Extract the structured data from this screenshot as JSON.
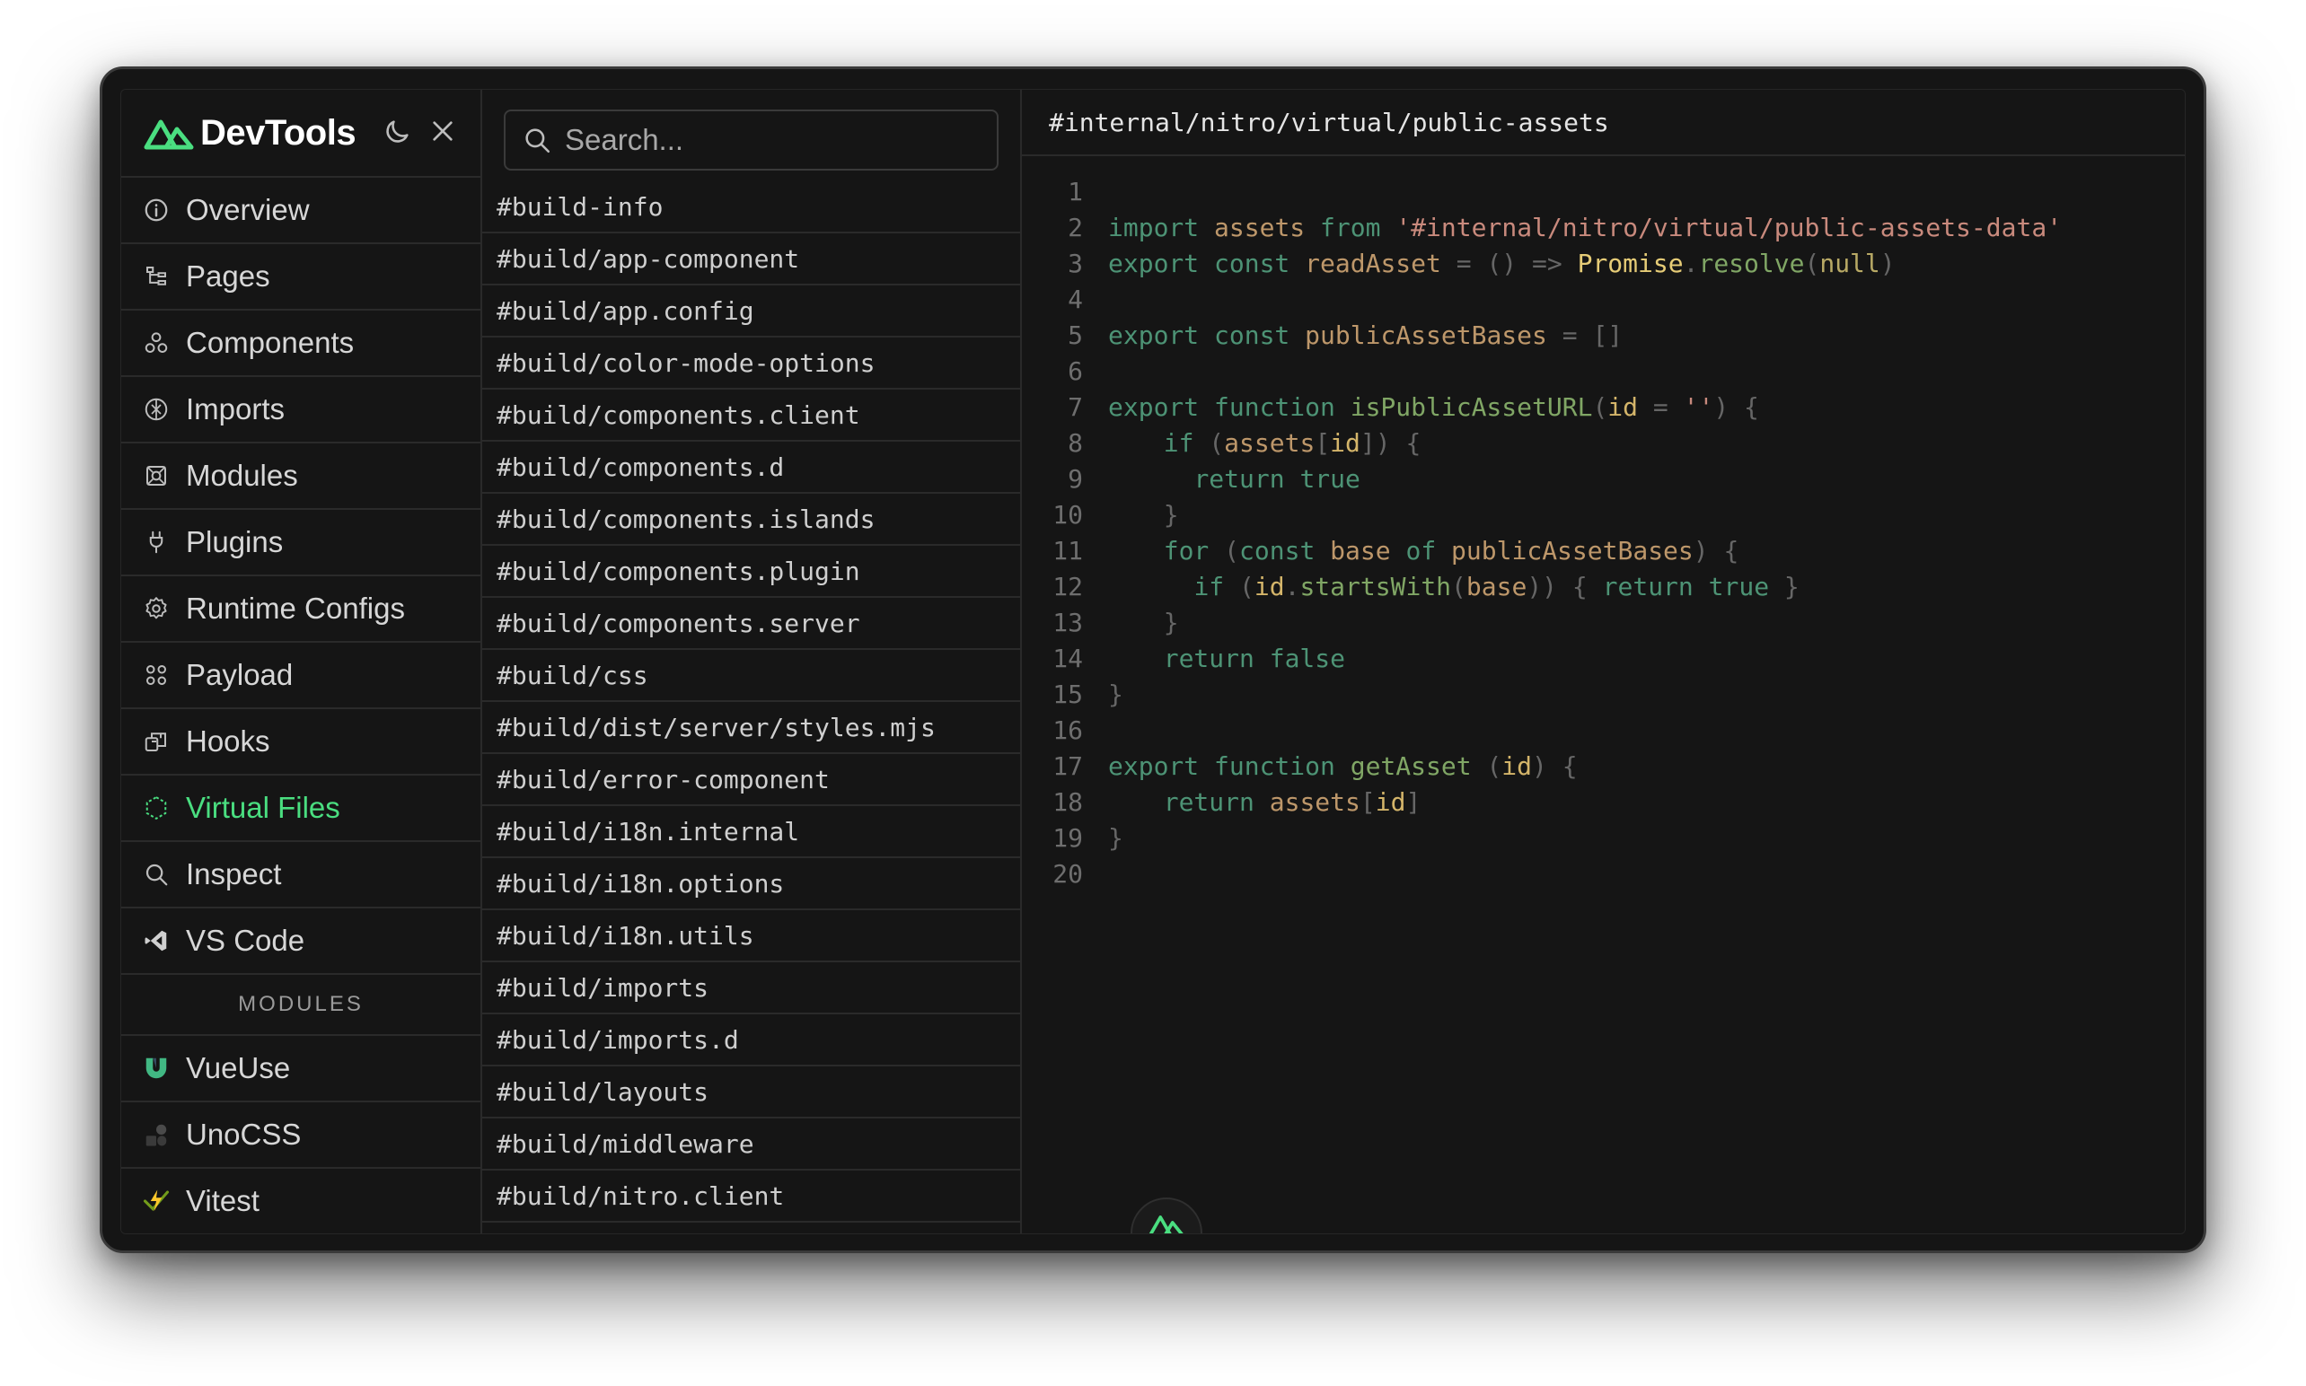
{
  "app": {
    "title": "DevTools",
    "accent": "#4ade80"
  },
  "sidebar": {
    "items": [
      {
        "label": "Overview",
        "icon": "info-circle-icon"
      },
      {
        "label": "Pages",
        "icon": "tree-icon"
      },
      {
        "label": "Components",
        "icon": "components-icon"
      },
      {
        "label": "Imports",
        "icon": "imports-icon"
      },
      {
        "label": "Modules",
        "icon": "modules-icon"
      },
      {
        "label": "Plugins",
        "icon": "plug-icon"
      },
      {
        "label": "Runtime Configs",
        "icon": "gear-icon"
      },
      {
        "label": "Payload",
        "icon": "payload-icon"
      },
      {
        "label": "Hooks",
        "icon": "hooks-icon"
      },
      {
        "label": "Virtual Files",
        "icon": "hexagon-icon",
        "active": true
      },
      {
        "label": "Inspect",
        "icon": "search-icon"
      },
      {
        "label": "VS Code",
        "icon": "vscode-icon"
      }
    ],
    "section_label": "MODULES",
    "modules": [
      {
        "label": "VueUse",
        "icon": "vueuse-icon"
      },
      {
        "label": "UnoCSS",
        "icon": "unocss-icon"
      },
      {
        "label": "Vitest",
        "icon": "vitest-icon"
      }
    ]
  },
  "search": {
    "placeholder": "Search..."
  },
  "files": [
    "#build-info",
    "#build/app-component",
    "#build/app.config",
    "#build/color-mode-options",
    "#build/components.client",
    "#build/components.d",
    "#build/components.islands",
    "#build/components.plugin",
    "#build/components.server",
    "#build/css",
    "#build/dist/server/styles.mjs",
    "#build/error-component",
    "#build/i18n.internal",
    "#build/i18n.options",
    "#build/i18n.utils",
    "#build/imports",
    "#build/imports.d",
    "#build/layouts",
    "#build/middleware",
    "#build/nitro.client"
  ],
  "editor": {
    "file_path": "#internal/nitro/virtual/public-assets",
    "lines": [
      [],
      [
        [
          "kw",
          "import "
        ],
        [
          "id",
          "assets "
        ],
        [
          "kw",
          "from "
        ],
        [
          "str",
          "'#internal/nitro/virtual/public-assets-data'"
        ]
      ],
      [
        [
          "kw",
          "export const "
        ],
        [
          "id",
          "readAsset "
        ],
        [
          "pu",
          "= () => "
        ],
        [
          "ty",
          "Promise"
        ],
        [
          "pu",
          "."
        ],
        [
          "fn",
          "resolve"
        ],
        [
          "pu",
          "("
        ],
        [
          "nu",
          "null"
        ],
        [
          "pu",
          ")"
        ]
      ],
      [],
      [
        [
          "kw",
          "export const "
        ],
        [
          "id",
          "publicAssetBases "
        ],
        [
          "pu",
          "= []"
        ]
      ],
      [],
      [
        [
          "kw",
          "export function "
        ],
        [
          "fn",
          "isPublicAssetURL"
        ],
        [
          "pu",
          "("
        ],
        [
          "prm",
          "id "
        ],
        [
          "pu",
          "= "
        ],
        [
          "str",
          "''"
        ],
        [
          "pu",
          ") {"
        ]
      ],
      [
        [
          "src",
          "  "
        ],
        [
          "kw",
          "if "
        ],
        [
          "pu",
          "("
        ],
        [
          "id",
          "assets"
        ],
        [
          "pu",
          "["
        ],
        [
          "prm",
          "id"
        ],
        [
          "pu",
          "]) {"
        ]
      ],
      [
        [
          "src",
          "    "
        ],
        [
          "kw",
          "return true"
        ]
      ],
      [
        [
          "src",
          "  "
        ],
        [
          "pu",
          "}"
        ]
      ],
      [
        [
          "src",
          "  "
        ],
        [
          "kw",
          "for "
        ],
        [
          "pu",
          "("
        ],
        [
          "kw",
          "const "
        ],
        [
          "id",
          "base "
        ],
        [
          "kw",
          "of "
        ],
        [
          "id",
          "publicAssetBases"
        ],
        [
          "pu",
          ") {"
        ]
      ],
      [
        [
          "src",
          "    "
        ],
        [
          "kw",
          "if "
        ],
        [
          "pu",
          "("
        ],
        [
          "prm",
          "id"
        ],
        [
          "pu",
          "."
        ],
        [
          "fn",
          "startsWith"
        ],
        [
          "pu",
          "("
        ],
        [
          "id",
          "base"
        ],
        [
          "pu",
          ")) { "
        ],
        [
          "kw",
          "return true "
        ],
        [
          "pu",
          "}"
        ]
      ],
      [
        [
          "src",
          "  "
        ],
        [
          "pu",
          "}"
        ]
      ],
      [
        [
          "src",
          "  "
        ],
        [
          "kw",
          "return false"
        ]
      ],
      [
        [
          "pu",
          "}"
        ]
      ],
      [],
      [
        [
          "kw",
          "export function "
        ],
        [
          "fn",
          "getAsset "
        ],
        [
          "pu",
          "("
        ],
        [
          "prm",
          "id"
        ],
        [
          "pu",
          ") {"
        ]
      ],
      [
        [
          "src",
          "  "
        ],
        [
          "kw",
          "return "
        ],
        [
          "id",
          "assets"
        ],
        [
          "pu",
          "["
        ],
        [
          "prm",
          "id"
        ],
        [
          "pu",
          "]"
        ]
      ],
      [
        [
          "pu",
          "}"
        ]
      ],
      []
    ]
  }
}
